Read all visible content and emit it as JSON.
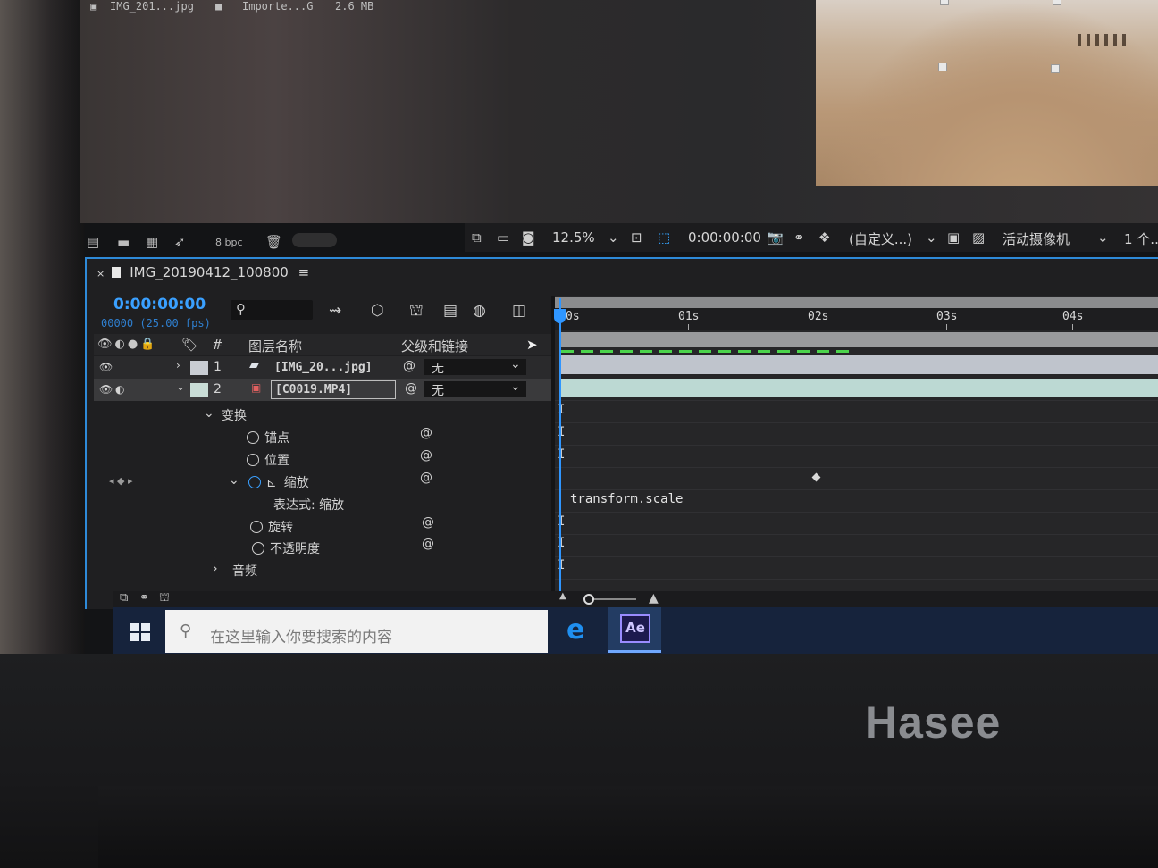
{
  "project": {
    "item_name": "IMG_201...jpg",
    "item_type": "Importe...G",
    "item_size": "2.6 MB",
    "bpc": "8 bpc"
  },
  "viewer_footer": {
    "zoom": "12.5%",
    "timecode": "0:00:00:00",
    "view_mode": "(自定义...)",
    "camera": "活动摄像机",
    "views": "1 个..."
  },
  "timeline": {
    "tab_title": "IMG_20190412_100800",
    "menu_glyph": "≡",
    "current_time": "0:00:00:00",
    "frame_info": "00000 (25.00 fps)",
    "ruler_ticks": [
      "0s",
      "01s",
      "02s",
      "03s",
      "04s"
    ],
    "headers": {
      "num": "#",
      "layer_name": "图层名称",
      "parent": "父级和链接"
    },
    "layers": [
      {
        "num": "1",
        "name": "[IMG_20...jpg]",
        "parent": "无"
      },
      {
        "num": "2",
        "name": "[C0019.MP4]",
        "parent": "无"
      }
    ],
    "properties": {
      "transform": "变换",
      "anchor": "锚点",
      "position": "位置",
      "scale": "缩放",
      "expression_label": "表达式: 缩放",
      "rotation": "旋转",
      "opacity": "不透明度",
      "audio": "音频"
    },
    "expression_text": "transform.scale"
  },
  "taskbar": {
    "search_placeholder": "在这里输入你要搜索的内容",
    "ae_label": "Ae"
  },
  "laptop": {
    "brand": "Hasee"
  },
  "colors": {
    "accent": "#2f96ff",
    "keyframe_green": "#4cd44c"
  }
}
